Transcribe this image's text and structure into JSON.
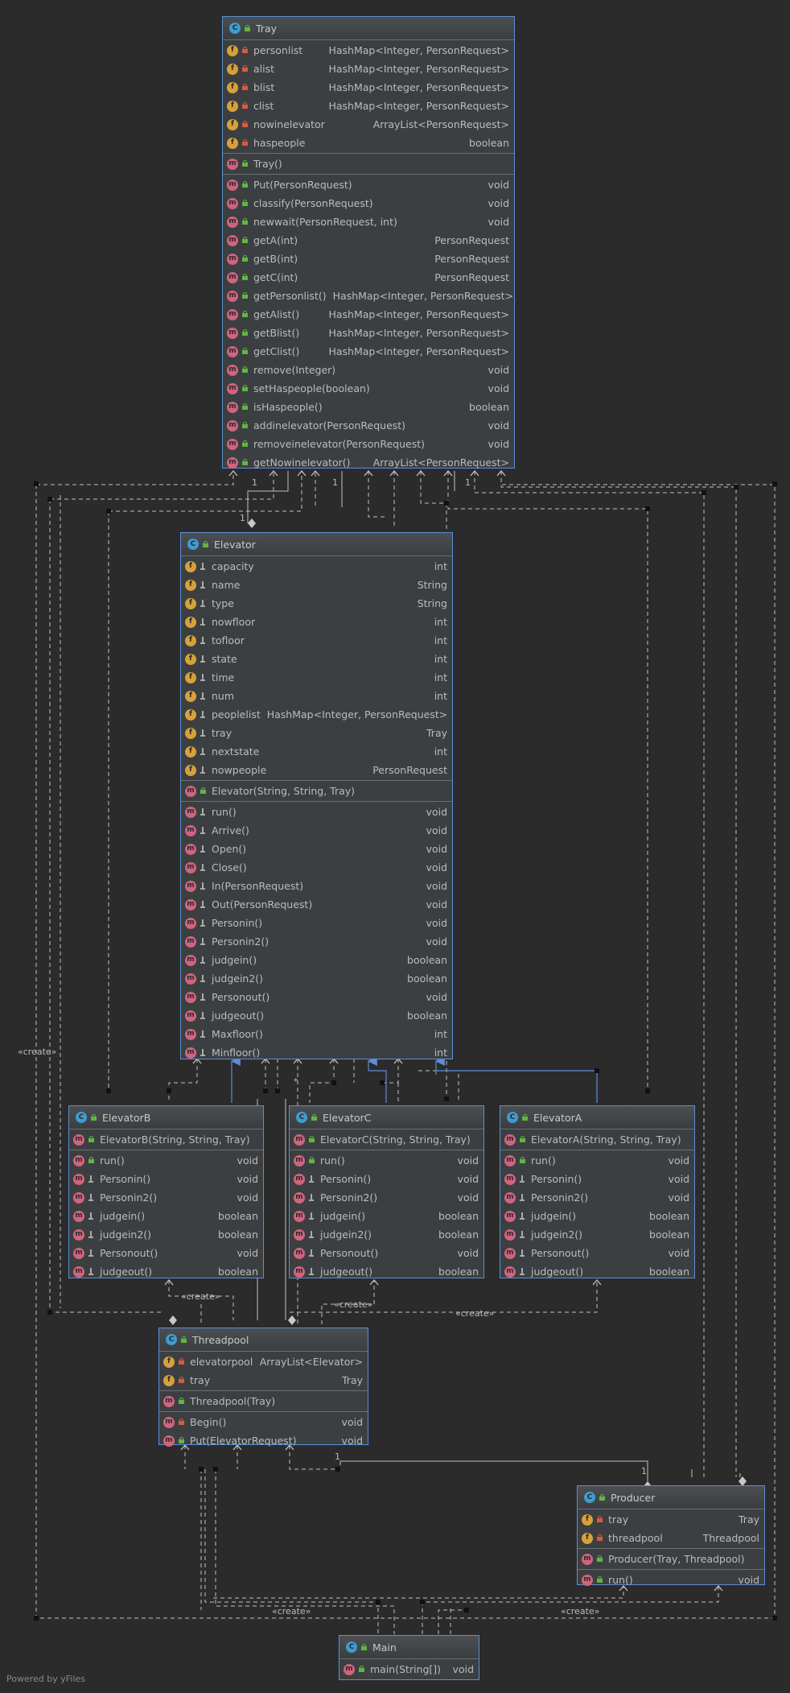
{
  "classes": {
    "tray": {
      "name": "Tray",
      "fields": [
        {
          "name": "personlist",
          "type": "HashMap<Integer, PersonRequest>",
          "vis": "priv"
        },
        {
          "name": "alist",
          "type": "HashMap<Integer, PersonRequest>",
          "vis": "priv"
        },
        {
          "name": "blist",
          "type": "HashMap<Integer, PersonRequest>",
          "vis": "priv"
        },
        {
          "name": "clist",
          "type": "HashMap<Integer, PersonRequest>",
          "vis": "priv"
        },
        {
          "name": "nowinelevator",
          "type": "ArrayList<PersonRequest>",
          "vis": "priv"
        },
        {
          "name": "haspeople",
          "type": "boolean",
          "vis": "priv"
        }
      ],
      "ctors": [
        {
          "name": "Tray()",
          "type": "",
          "vis": "pub"
        }
      ],
      "methods": [
        {
          "name": "Put(PersonRequest)",
          "type": "void",
          "vis": "pub"
        },
        {
          "name": "classify(PersonRequest)",
          "type": "void",
          "vis": "pub"
        },
        {
          "name": "newwait(PersonRequest, int)",
          "type": "void",
          "vis": "pub"
        },
        {
          "name": "getA(int)",
          "type": "PersonRequest",
          "vis": "pub"
        },
        {
          "name": "getB(int)",
          "type": "PersonRequest",
          "vis": "pub"
        },
        {
          "name": "getC(int)",
          "type": "PersonRequest",
          "vis": "pub"
        },
        {
          "name": "getPersonlist()",
          "type": "HashMap<Integer, PersonRequest>",
          "vis": "pub"
        },
        {
          "name": "getAlist()",
          "type": "HashMap<Integer, PersonRequest>",
          "vis": "pub"
        },
        {
          "name": "getBlist()",
          "type": "HashMap<Integer, PersonRequest>",
          "vis": "pub"
        },
        {
          "name": "getClist()",
          "type": "HashMap<Integer, PersonRequest>",
          "vis": "pub"
        },
        {
          "name": "remove(Integer)",
          "type": "void",
          "vis": "pub"
        },
        {
          "name": "setHaspeople(boolean)",
          "type": "void",
          "vis": "pub"
        },
        {
          "name": "isHaspeople()",
          "type": "boolean",
          "vis": "pub"
        },
        {
          "name": "addinelevator(PersonRequest)",
          "type": "void",
          "vis": "pub"
        },
        {
          "name": "removeinelevator(PersonRequest)",
          "type": "void",
          "vis": "pub"
        },
        {
          "name": "getNowinelevator()",
          "type": "ArrayList<PersonRequest>",
          "vis": "pub"
        }
      ]
    },
    "elevator": {
      "name": "Elevator",
      "fields": [
        {
          "name": "capacity",
          "type": "int",
          "vis": "pkg"
        },
        {
          "name": "name",
          "type": "String",
          "vis": "pkg"
        },
        {
          "name": "type",
          "type": "String",
          "vis": "pkg"
        },
        {
          "name": "nowfloor",
          "type": "int",
          "vis": "pkg"
        },
        {
          "name": "tofloor",
          "type": "int",
          "vis": "pkg"
        },
        {
          "name": "state",
          "type": "int",
          "vis": "pkg"
        },
        {
          "name": "time",
          "type": "int",
          "vis": "pkg"
        },
        {
          "name": "num",
          "type": "int",
          "vis": "pkg"
        },
        {
          "name": "peoplelist",
          "type": "HashMap<Integer, PersonRequest>",
          "vis": "pkg"
        },
        {
          "name": "tray",
          "type": "Tray",
          "vis": "pkg"
        },
        {
          "name": "nextstate",
          "type": "int",
          "vis": "pkg"
        },
        {
          "name": "nowpeople",
          "type": "PersonRequest",
          "vis": "pkg"
        }
      ],
      "ctors": [
        {
          "name": "Elevator(String, String, Tray)",
          "type": "",
          "vis": "pub"
        }
      ],
      "methods": [
        {
          "name": "run()",
          "type": "void",
          "vis": "pkg"
        },
        {
          "name": "Arrive()",
          "type": "void",
          "vis": "pkg"
        },
        {
          "name": "Open()",
          "type": "void",
          "vis": "pkg"
        },
        {
          "name": "Close()",
          "type": "void",
          "vis": "pkg"
        },
        {
          "name": "In(PersonRequest)",
          "type": "void",
          "vis": "pkg"
        },
        {
          "name": "Out(PersonRequest)",
          "type": "void",
          "vis": "pkg"
        },
        {
          "name": "Personin()",
          "type": "void",
          "vis": "pkg"
        },
        {
          "name": "Personin2()",
          "type": "void",
          "vis": "pkg"
        },
        {
          "name": "judgein()",
          "type": "boolean",
          "vis": "pkg"
        },
        {
          "name": "judgein2()",
          "type": "boolean",
          "vis": "pkg"
        },
        {
          "name": "Personout()",
          "type": "void",
          "vis": "pkg"
        },
        {
          "name": "judgeout()",
          "type": "boolean",
          "vis": "pkg"
        },
        {
          "name": "Maxfloor()",
          "type": "int",
          "vis": "pkg"
        },
        {
          "name": "Minfloor()",
          "type": "int",
          "vis": "pkg"
        }
      ]
    },
    "elevatorB": {
      "name": "ElevatorB",
      "fields": [],
      "ctors": [
        {
          "name": "ElevatorB(String, String, Tray)",
          "type": "",
          "vis": "pub"
        }
      ],
      "methods": [
        {
          "name": "run()",
          "type": "void",
          "vis": "pub"
        },
        {
          "name": "Personin()",
          "type": "void",
          "vis": "pkg"
        },
        {
          "name": "Personin2()",
          "type": "void",
          "vis": "pkg"
        },
        {
          "name": "judgein()",
          "type": "boolean",
          "vis": "pkg"
        },
        {
          "name": "judgein2()",
          "type": "boolean",
          "vis": "pkg"
        },
        {
          "name": "Personout()",
          "type": "void",
          "vis": "pkg"
        },
        {
          "name": "judgeout()",
          "type": "boolean",
          "vis": "pkg"
        }
      ]
    },
    "elevatorC": {
      "name": "ElevatorC",
      "fields": [],
      "ctors": [
        {
          "name": "ElevatorC(String, String, Tray)",
          "type": "",
          "vis": "pub"
        }
      ],
      "methods": [
        {
          "name": "run()",
          "type": "void",
          "vis": "pub"
        },
        {
          "name": "Personin()",
          "type": "void",
          "vis": "pkg"
        },
        {
          "name": "Personin2()",
          "type": "void",
          "vis": "pkg"
        },
        {
          "name": "judgein()",
          "type": "boolean",
          "vis": "pkg"
        },
        {
          "name": "judgein2()",
          "type": "boolean",
          "vis": "pkg"
        },
        {
          "name": "Personout()",
          "type": "void",
          "vis": "pkg"
        },
        {
          "name": "judgeout()",
          "type": "boolean",
          "vis": "pkg"
        }
      ]
    },
    "elevatorA": {
      "name": "ElevatorA",
      "fields": [],
      "ctors": [
        {
          "name": "ElevatorA(String, String, Tray)",
          "type": "",
          "vis": "pub"
        }
      ],
      "methods": [
        {
          "name": "run()",
          "type": "void",
          "vis": "pub"
        },
        {
          "name": "Personin()",
          "type": "void",
          "vis": "pkg"
        },
        {
          "name": "Personin2()",
          "type": "void",
          "vis": "pkg"
        },
        {
          "name": "judgein()",
          "type": "boolean",
          "vis": "pkg"
        },
        {
          "name": "judgein2()",
          "type": "boolean",
          "vis": "pkg"
        },
        {
          "name": "Personout()",
          "type": "void",
          "vis": "pkg"
        },
        {
          "name": "judgeout()",
          "type": "boolean",
          "vis": "pkg"
        }
      ]
    },
    "threadpool": {
      "name": "Threadpool",
      "fields": [
        {
          "name": "elevatorpool",
          "type": "ArrayList<Elevator>",
          "vis": "priv"
        },
        {
          "name": "tray",
          "type": "Tray",
          "vis": "priv"
        }
      ],
      "ctors": [
        {
          "name": "Threadpool(Tray)",
          "type": "",
          "vis": "pub"
        }
      ],
      "methods": [
        {
          "name": "Begin()",
          "type": "void",
          "vis": "priv"
        },
        {
          "name": "Put(ElevatorRequest)",
          "type": "void",
          "vis": "pub"
        }
      ]
    },
    "producer": {
      "name": "Producer",
      "fields": [
        {
          "name": "tray",
          "type": "Tray",
          "vis": "priv"
        },
        {
          "name": "threadpool",
          "type": "Threadpool",
          "vis": "priv"
        }
      ],
      "ctors": [
        {
          "name": "Producer(Tray, Threadpool)",
          "type": "",
          "vis": "pub"
        }
      ],
      "methods": [
        {
          "name": "run()",
          "type": "void",
          "vis": "pub"
        }
      ]
    },
    "main": {
      "name": "Main",
      "fields": [],
      "ctors": [],
      "methods": [
        {
          "name": "main(String[])",
          "type": "void",
          "vis": "pub"
        }
      ]
    }
  },
  "labels": {
    "create": "«create»",
    "one": "1",
    "star": "*"
  },
  "footer": "Powered by yFiles",
  "colors": {
    "edge": "#c0c0c0",
    "inherit": "#5b8ed8",
    "class_icon": "#3f9cd1",
    "field_icon": "#d7a13a",
    "method_icon": "#d0647e"
  }
}
